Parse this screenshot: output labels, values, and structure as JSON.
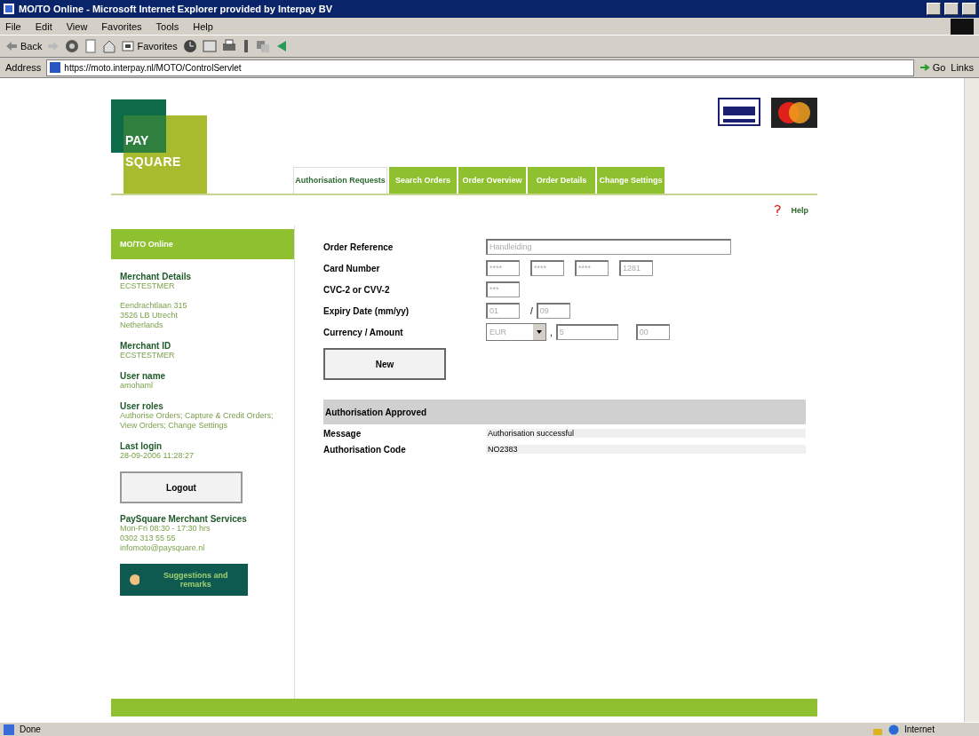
{
  "window": {
    "title": "MO/TO Online - Microsoft Internet Explorer provided by Interpay BV"
  },
  "menu": [
    "File",
    "Edit",
    "View",
    "Favorites",
    "Tools",
    "Help"
  ],
  "toolbar": {
    "back": "Back",
    "favorites": "Favorites"
  },
  "address": {
    "label": "Address",
    "url": "https://moto.interpay.nl/MOTO/ControlServlet",
    "go": "Go",
    "links": "Links"
  },
  "logo": {
    "line_1": "PAY",
    "line_2": "SQUARE"
  },
  "tabs": [
    {
      "label": "Authorisation Requests",
      "selected": true
    },
    {
      "label": "Search Orders",
      "selected": false
    },
    {
      "label": "Order Overview",
      "selected": false
    },
    {
      "label": "Order Details",
      "selected": false
    },
    {
      "label": "Change Settings",
      "selected": false
    }
  ],
  "help": "Help",
  "sidebar": {
    "title": "MO/TO Online",
    "sections": [
      {
        "heading": "Merchant Details",
        "lines": [
          "ECSTESTMER"
        ],
        "address": [
          "Eendrachtlaan 315",
          "3526 LB Utrecht",
          "Netherlands"
        ]
      },
      {
        "heading": "Merchant ID",
        "lines": [
          "ECSTESTMER"
        ]
      },
      {
        "heading": "User name",
        "lines": [
          "amohaml"
        ]
      },
      {
        "heading": "User roles",
        "lines": [
          "Authorise Orders; Capture & Credit Orders; View Orders; Change Settings"
        ]
      },
      {
        "heading": "Last login",
        "lines": [
          "28-09-2006 11:28:27"
        ]
      }
    ],
    "logout": "Logout",
    "service": {
      "heading": "PaySquare Merchant Services",
      "lines": [
        "Mon-Fri 08:30 - 17:30 hrs",
        "0302 313 55 55",
        "infomoto@paysquare.nl"
      ]
    },
    "suggestions": "Suggestions and remarks"
  },
  "form": [
    {
      "label": "Order Reference",
      "disabled": true,
      "items": [
        {
          "kind": "wide",
          "value": "Handleiding"
        }
      ]
    },
    {
      "label": "Card Number",
      "disabled": true,
      "items": [
        {
          "kind": "short",
          "value": "****"
        },
        {
          "kind": "short",
          "value": "****"
        },
        {
          "kind": "short",
          "value": "****"
        },
        {
          "kind": "short",
          "value": "1281"
        }
      ]
    },
    {
      "label": "CVC-2 or CVV-2",
      "disabled": true,
      "items": [
        {
          "kind": "short",
          "value": "***"
        }
      ]
    },
    {
      "label": "Expiry Date (mm/yy)",
      "disabled": true,
      "items": [
        {
          "kind": "short",
          "value": "01"
        },
        {
          "kind": "sep",
          "value": "/"
        },
        {
          "kind": "short",
          "value": "09"
        }
      ]
    },
    {
      "label": "Currency / Amount",
      "disabled": true,
      "items": [
        {
          "kind": "select",
          "value": "EUR"
        },
        {
          "kind": "sep",
          "value": ","
        },
        {
          "kind": "medium",
          "value": "5"
        },
        {
          "kind": "gap",
          "value": ""
        },
        {
          "kind": "short",
          "value": "00"
        }
      ]
    }
  ],
  "new_button": "New",
  "result": {
    "title": "Authorisation Approved",
    "rows": [
      {
        "label": "Message",
        "value": "Authorisation successful"
      },
      {
        "label": "Authorisation Code",
        "value": "NO2383"
      }
    ]
  },
  "status_bar": {
    "text": "Done",
    "zone": "Internet"
  }
}
